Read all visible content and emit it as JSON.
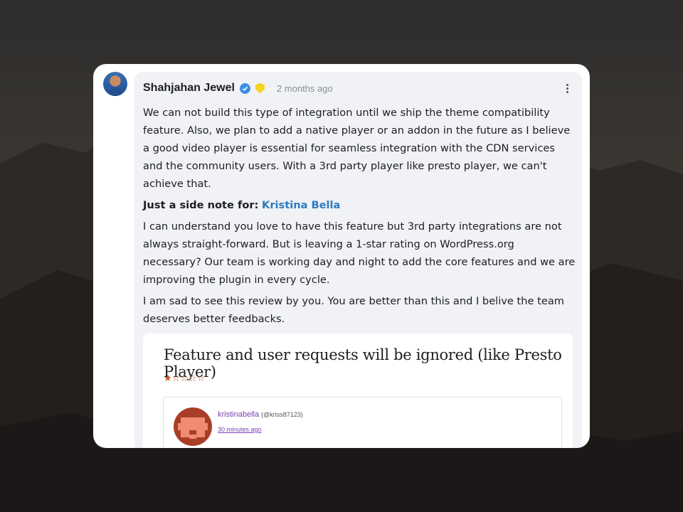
{
  "comment": {
    "author": "Shahjahan Jewel",
    "time": "2 months ago",
    "paragraph_1": "We can not build this type of integration until we ship the theme compatibility feature. Also, we plan to add a native player or an addon in the future as I believe a good video player is essential for seamless integration with the CDN services and the community users. With a 3rd party player like presto player, we can't achieve that.",
    "side_note_label": "Just a side note for:",
    "side_note_mention": "Kristina Bella",
    "paragraph_2": "I can understand you love to have this feature but 3rd party integrations are not always straight-forward. But is leaving a 1-star rating on WordPress.org necessary? Our team is working day and night to add the core features and we are improving the plugin in every cycle.",
    "paragraph_3": "I am sad to see this review by you. You are better than this and I belive the team deserves better feedbacks."
  },
  "review_screenshot": {
    "title": "Feature and user requests will be ignored (like Presto Player)",
    "rating": 1,
    "rating_max": 5,
    "star_filled": "★",
    "star_empty": "☆☆☆☆",
    "reviewer_name": "kristinabella",
    "reviewer_handle": "(@kriss87123)",
    "review_time": "30 minutes ago"
  },
  "colors": {
    "mention": "#2f7abf",
    "verified": "#3d8ee8",
    "badge": "#f5d322",
    "star": "#c2572e",
    "reviewer_link": "#7b3fb3"
  },
  "icons": [
    "verified-icon",
    "badge-icon",
    "more-options-icon",
    "star-icon",
    "avatar"
  ]
}
